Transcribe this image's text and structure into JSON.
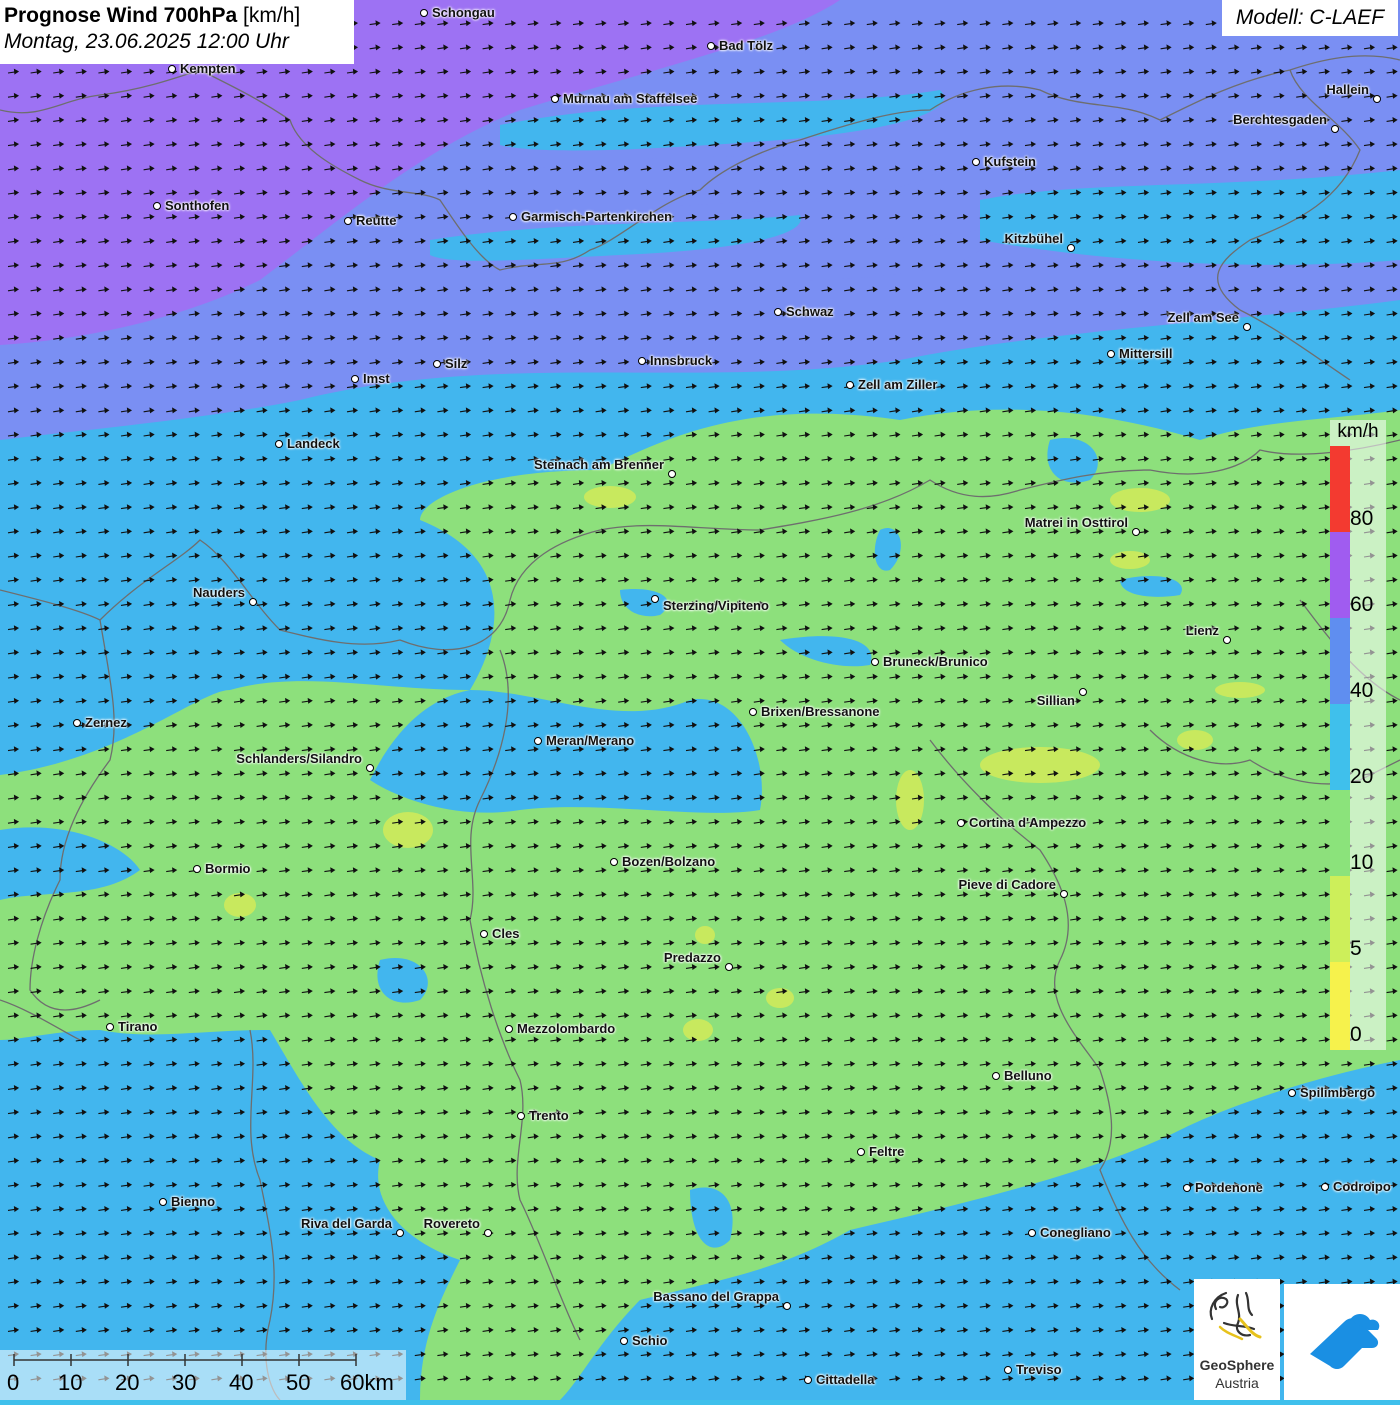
{
  "title": {
    "main": "Prognose Wind 700hPa",
    "unit": "[km/h]",
    "date": "Montag, 23.06.2025 12:00 Uhr"
  },
  "model": "Modell: C-LAEF",
  "legend": {
    "unit": "km/h",
    "labels": [
      "80",
      "60",
      "40",
      "20",
      "10",
      "5",
      "0"
    ],
    "colors": {
      "above_80": "#f33a30",
      "60_80": "#a05cf0",
      "40_60": "#5f8ef0",
      "20_40": "#3fc0ec",
      "10_20": "#8be37b",
      "5_10": "#cdef5a",
      "0_5": "#f6f24c"
    }
  },
  "map_fill_colors": {
    "band_60_80": "#9d72f3",
    "band_40_60": "#7a8ff3",
    "band_20_40": "#42b6ee",
    "band_10_20": "#8de07c",
    "band_5_10": "#c8e95e",
    "border": "#7a7a7a"
  },
  "wind_direction": "west-southwest to east-northeast",
  "scale": {
    "labels": [
      "0",
      "10",
      "20",
      "30",
      "40",
      "50",
      "60km"
    ]
  },
  "cities": [
    {
      "name": "Schongau"
    },
    {
      "name": "Bad Tölz"
    },
    {
      "name": "Kempten"
    },
    {
      "name": "Murnau am Staffelsee"
    },
    {
      "name": "Hallein"
    },
    {
      "name": "Berchtesgaden"
    },
    {
      "name": "Kufstein"
    },
    {
      "name": "Sonthofen"
    },
    {
      "name": "Reutte"
    },
    {
      "name": "Garmisch-Partenkirchen"
    },
    {
      "name": "Kitzbühel"
    },
    {
      "name": "Schwaz"
    },
    {
      "name": "Zell am See"
    },
    {
      "name": "Mittersill"
    },
    {
      "name": "Innsbruck"
    },
    {
      "name": "Silz"
    },
    {
      "name": "Imst"
    },
    {
      "name": "Zell am Ziller"
    },
    {
      "name": "Landeck"
    },
    {
      "name": "Steinach am Brenner"
    },
    {
      "name": "Matrei in Osttirol"
    },
    {
      "name": "Nauders"
    },
    {
      "name": "Sterzing/Vipiteno"
    },
    {
      "name": "Lienz"
    },
    {
      "name": "Bruneck/Brunico"
    },
    {
      "name": "Sillian"
    },
    {
      "name": "Zernez"
    },
    {
      "name": "Brixen/Bressanone"
    },
    {
      "name": "Meran/Merano"
    },
    {
      "name": "Schlanders/Silandro"
    },
    {
      "name": "Cortina d'Ampezzo"
    },
    {
      "name": "Bozen/Bolzano"
    },
    {
      "name": "Bormio"
    },
    {
      "name": "Pieve di Cadore"
    },
    {
      "name": "Cles"
    },
    {
      "name": "Predazzo"
    },
    {
      "name": "Tirano"
    },
    {
      "name": "Mezzolombardo"
    },
    {
      "name": "Belluno"
    },
    {
      "name": "Spilimbergo"
    },
    {
      "name": "Trento"
    },
    {
      "name": "Feltre"
    },
    {
      "name": "Bienno"
    },
    {
      "name": "Pordenone"
    },
    {
      "name": "Codroipo"
    },
    {
      "name": "Riva del Garda"
    },
    {
      "name": "Rovereto"
    },
    {
      "name": "Conegliano"
    },
    {
      "name": "Bassano del Grappa"
    },
    {
      "name": "Schio"
    },
    {
      "name": "Treviso"
    },
    {
      "name": "Cittadella"
    }
  ],
  "logos": {
    "geosphere_line1": "GeoSphere",
    "geosphere_line2": "Austria"
  }
}
